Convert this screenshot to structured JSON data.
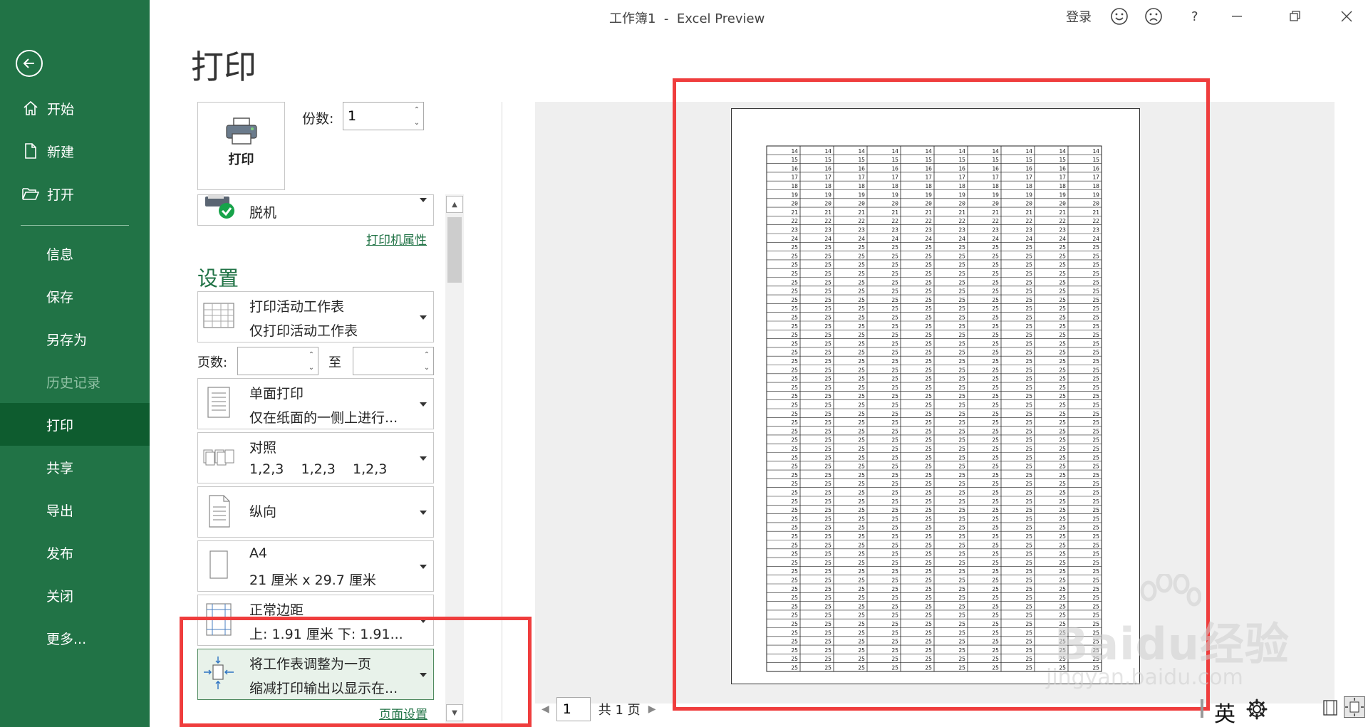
{
  "window": {
    "title": "工作簿1  -  Excel Preview",
    "signin": "登录",
    "help": "?"
  },
  "nav": {
    "items": [
      {
        "label": "开始",
        "icon": "home-icon"
      },
      {
        "label": "新建",
        "icon": "new-document-icon"
      },
      {
        "label": "打开",
        "icon": "open-folder-icon"
      },
      {
        "label": "信息"
      },
      {
        "label": "保存"
      },
      {
        "label": "另存为"
      },
      {
        "label": "历史记录",
        "disabled": true
      },
      {
        "label": "打印",
        "active": true
      },
      {
        "label": "共享"
      },
      {
        "label": "导出"
      },
      {
        "label": "发布"
      },
      {
        "label": "关闭"
      },
      {
        "label": "更多..."
      }
    ]
  },
  "print": {
    "heading": "打印",
    "print_button": "打印",
    "copies_label": "份数:",
    "copies_value": "1",
    "printer_name": "脱机",
    "printer_properties": "打印机属性",
    "settings_heading": "设置",
    "what": {
      "line1": "打印活动工作表",
      "line2": "仅打印活动工作表"
    },
    "pages_label": "页数:",
    "pages_to": "至",
    "sides": {
      "line1": "单面打印",
      "line2": "仅在纸面的一侧上进行..."
    },
    "collate": {
      "line1": "对照",
      "line2": "1,2,3    1,2,3    1,2,3"
    },
    "orientation": {
      "line1": "纵向"
    },
    "paper": {
      "line1": "A4",
      "line2": "21 厘米 x 29.7 厘米"
    },
    "margins": {
      "line1": "正常边距",
      "line2": "上: 1.91 厘米 下: 1.91..."
    },
    "scaling": {
      "line1": "将工作表调整为一页",
      "line2": "缩减打印输出以显示在..."
    },
    "page_setup": "页面设置"
  },
  "preview": {
    "current_page": "1",
    "of_pages": "共 1 页",
    "columns": 10,
    "rows": [
      14,
      15,
      16,
      17,
      18,
      19,
      20,
      21,
      22,
      23,
      24,
      25,
      25,
      25,
      25,
      25,
      25,
      25,
      25,
      25,
      25,
      25,
      25,
      25,
      25,
      25,
      25,
      25,
      25,
      25,
      25,
      25,
      25,
      25,
      25,
      25,
      25,
      25,
      25,
      25,
      25,
      25,
      25,
      25,
      25,
      25,
      25,
      25,
      25,
      25,
      25,
      25,
      25,
      25,
      25,
      25,
      25,
      25,
      25,
      25
    ]
  },
  "ime": "英",
  "watermark": {
    "brand": "Baidu经验",
    "url": "jingyan.baidu.com"
  },
  "colors": {
    "nav_bg": "#217346",
    "nav_active": "#0e5c2f",
    "accent": "#217346",
    "annotation": "#ef3d3d"
  }
}
